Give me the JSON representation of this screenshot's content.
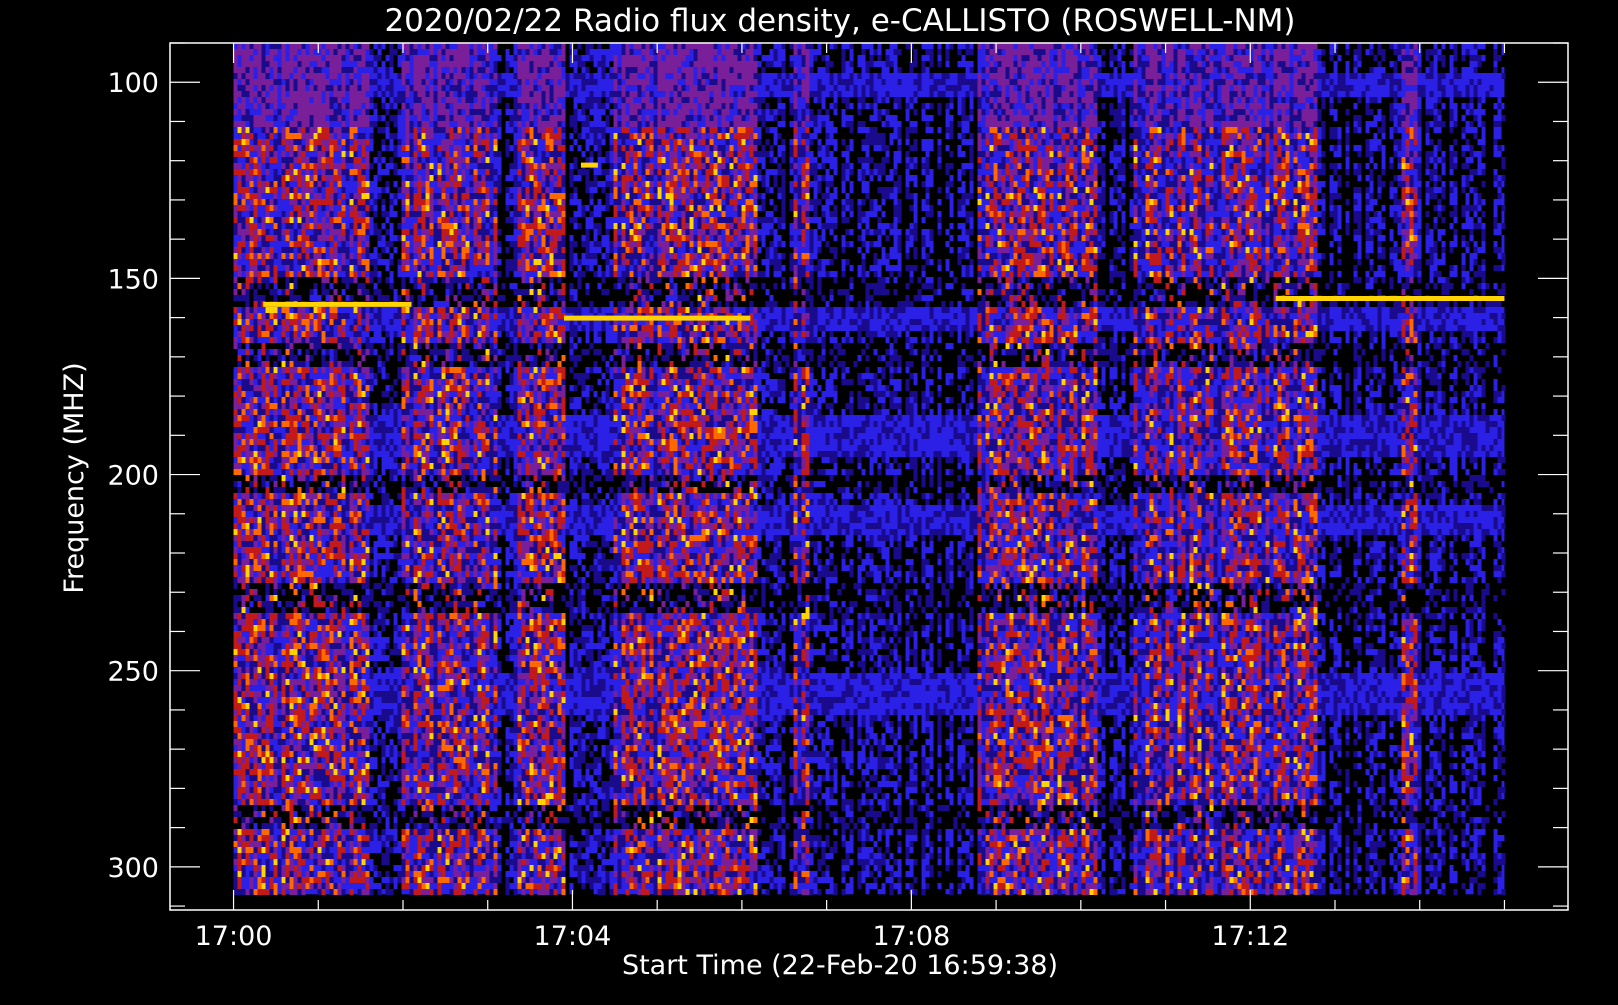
{
  "chart_data": {
    "type": "heatmap",
    "title": "2020/02/22  Radio flux density, e-CALLISTO (ROSWELL-NM)",
    "xlabel": "Start Time (22-Feb-20 16:59:38)",
    "ylabel": "Frequency (MHZ)",
    "x_ticks": [
      "17:00",
      "17:04",
      "17:08",
      "17:12"
    ],
    "x_tick_minutes": [
      0,
      4,
      8,
      12
    ],
    "x_range_minutes": [
      -0.75,
      15.75
    ],
    "data_x_range_minutes": [
      0,
      15
    ],
    "y_ticks": [
      100,
      150,
      200,
      250,
      300
    ],
    "ylim": [
      90,
      311
    ],
    "data_y_range": [
      90,
      307
    ],
    "y_inverted": true,
    "colormap": [
      "#000000",
      "#1a0a8c",
      "#2a20e6",
      "#7a1f9a",
      "#c21a1a",
      "#ff6a00",
      "#ffd400",
      "#ffffff"
    ],
    "active_intervals_minutes": [
      [
        0,
        1.6
      ],
      [
        2.0,
        3.1
      ],
      [
        3.3,
        3.9
      ],
      [
        4.5,
        6.2
      ],
      [
        6.6,
        6.8
      ],
      [
        8.8,
        10.2
      ],
      [
        10.6,
        12.8
      ],
      [
        13.8,
        14.0
      ]
    ],
    "quiet_intervals_minutes": [
      [
        1.7,
        2.0
      ],
      [
        4.0,
        4.4
      ],
      [
        6.8,
        8.7
      ],
      [
        12.9,
        13.7
      ],
      [
        14.1,
        15.0
      ]
    ],
    "narrowband_emission": [
      {
        "f_mhz": 156.5,
        "t_start": 0.35,
        "t_end": 2.1
      },
      {
        "f_mhz": 160,
        "t_start": 3.9,
        "t_end": 6.1
      },
      {
        "f_mhz": 155,
        "t_start": 12.3,
        "t_end": 15.0
      },
      {
        "f_mhz": 121,
        "t_start": 4.1,
        "t_end": 4.3
      }
    ],
    "dark_bands_mhz": [
      [
        150,
        157
      ],
      [
        166,
        172
      ],
      [
        200,
        205
      ],
      [
        228,
        235
      ],
      [
        285,
        290
      ]
    ],
    "bright_bands_mhz": [
      [
        97,
        104
      ],
      [
        158,
        163
      ],
      [
        185,
        195
      ],
      [
        208,
        216
      ],
      [
        250,
        262
      ]
    ]
  }
}
